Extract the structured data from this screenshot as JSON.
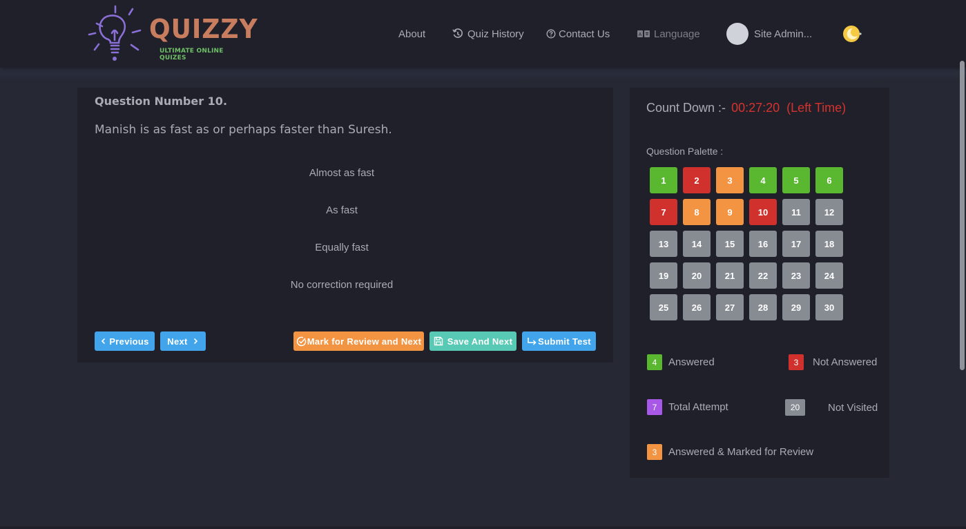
{
  "header": {
    "logo": {
      "title": "QUIZZY",
      "subtitle": "ULTIMATE ONLINE QUIZES",
      "icon": "lightbulb-icon"
    },
    "nav": {
      "about": "About",
      "quiz_history": "Quiz History",
      "contact_us": "Contact Us",
      "language": "Language",
      "user": "Site Admin..."
    },
    "icons": {
      "history": "history-icon",
      "contact": "help-circle-icon",
      "language": "translate-icon",
      "avatar": "avatar",
      "theme": "moon-stars-icon"
    }
  },
  "question": {
    "number_label": "Question Number 10.",
    "text": "Manish is as fast as or perhaps faster than Suresh.",
    "options": [
      "Almost as fast",
      "As fast",
      "Equally fast",
      "No correction required"
    ]
  },
  "actions": {
    "previous": "Previous",
    "next": "Next",
    "mark_review": "Mark for Review and Next",
    "save_next": "Save And Next",
    "submit": "Submit Test"
  },
  "sidebar": {
    "countdown_label": "Count Down :-",
    "countdown_time": "00:27:20",
    "countdown_suffix": "(Left Time)",
    "palette_label": "Question Palette :",
    "palette": [
      {
        "n": "1",
        "status": "answered"
      },
      {
        "n": "2",
        "status": "not_answered"
      },
      {
        "n": "3",
        "status": "marked"
      },
      {
        "n": "4",
        "status": "answered"
      },
      {
        "n": "5",
        "status": "answered"
      },
      {
        "n": "6",
        "status": "answered"
      },
      {
        "n": "7",
        "status": "not_answered"
      },
      {
        "n": "8",
        "status": "marked"
      },
      {
        "n": "9",
        "status": "marked"
      },
      {
        "n": "10",
        "status": "not_answered"
      },
      {
        "n": "11",
        "status": "not_visited"
      },
      {
        "n": "12",
        "status": "not_visited"
      },
      {
        "n": "13",
        "status": "not_visited"
      },
      {
        "n": "14",
        "status": "not_visited"
      },
      {
        "n": "15",
        "status": "not_visited"
      },
      {
        "n": "16",
        "status": "not_visited"
      },
      {
        "n": "17",
        "status": "not_visited"
      },
      {
        "n": "18",
        "status": "not_visited"
      },
      {
        "n": "19",
        "status": "not_visited"
      },
      {
        "n": "20",
        "status": "not_visited"
      },
      {
        "n": "21",
        "status": "not_visited"
      },
      {
        "n": "22",
        "status": "not_visited"
      },
      {
        "n": "23",
        "status": "not_visited"
      },
      {
        "n": "24",
        "status": "not_visited"
      },
      {
        "n": "25",
        "status": "not_visited"
      },
      {
        "n": "26",
        "status": "not_visited"
      },
      {
        "n": "27",
        "status": "not_visited"
      },
      {
        "n": "28",
        "status": "not_visited"
      },
      {
        "n": "29",
        "status": "not_visited"
      },
      {
        "n": "30",
        "status": "not_visited"
      }
    ],
    "legend": {
      "answered": {
        "count": "4",
        "label": "Answered"
      },
      "not_answered": {
        "count": "3",
        "label": "Not Answered"
      },
      "total_attempt": {
        "count": "7",
        "label": "Total Attempt"
      },
      "not_visited": {
        "count": "20",
        "label": "Not Visited"
      },
      "marked": {
        "count": "3",
        "label": "Answered & Marked for Review"
      }
    }
  },
  "colors": {
    "answered": "#5ab830",
    "not_answered": "#d0312d",
    "marked": "#f39443",
    "not_visited": "#878c93",
    "total_attempt": "#a758e6",
    "primary": "#42a5ec",
    "teal": "#57c9b4",
    "timer": "#d6332e"
  }
}
